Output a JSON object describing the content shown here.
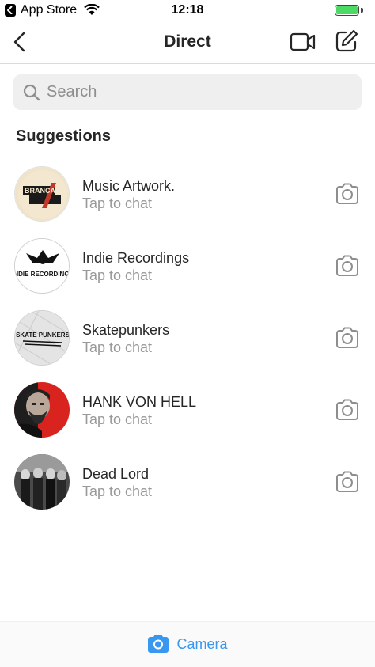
{
  "status_bar": {
    "back_app": "App Store",
    "time": "12:18",
    "battery_level": 1.0
  },
  "nav": {
    "title": "Direct",
    "icons": [
      "back-chevron-icon",
      "video-camera-icon",
      "compose-icon"
    ]
  },
  "search": {
    "placeholder": "Search",
    "value": ""
  },
  "suggestions": {
    "title": "Suggestions",
    "items": [
      {
        "name": "Music Artwork.",
        "subtitle": "Tap to chat",
        "avatar_logo": "BRANCA STUDIO"
      },
      {
        "name": "Indie Recordings",
        "subtitle": "Tap to chat",
        "avatar_logo": "INDIE RECORDINGS"
      },
      {
        "name": "Skatepunkers",
        "subtitle": "Tap to chat",
        "avatar_logo": "SKATE PUNKERS"
      },
      {
        "name": "HANK VON HELL",
        "subtitle": "Tap to chat"
      },
      {
        "name": "Dead Lord",
        "subtitle": "Tap to chat"
      }
    ]
  },
  "bottom_bar": {
    "label": "Camera"
  },
  "colors": {
    "accent": "#3897f0",
    "text": "#262626",
    "secondary_text": "#999999",
    "search_bg": "#efefef",
    "battery": "#4cd964"
  }
}
